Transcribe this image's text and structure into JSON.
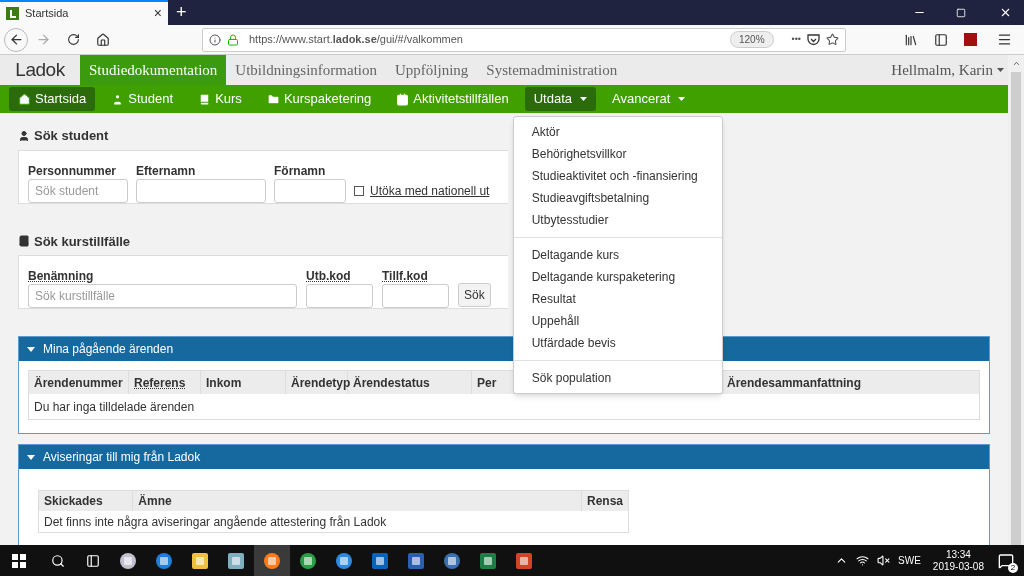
{
  "browser": {
    "tab": {
      "title": "Startsida",
      "close": "×"
    },
    "new_tab": "+",
    "url": "https://www.start.**ladok.se**/gui/#/valkommen",
    "zoom": "120%",
    "more": "•••"
  },
  "top_menu": {
    "logo": "Ladok",
    "items": [
      {
        "label": "Studiedokumentation",
        "selected": true
      },
      {
        "label": "Utbildningsinformation",
        "selected": false
      },
      {
        "label": "Uppföljning",
        "selected": false
      },
      {
        "label": "Systemadministration",
        "selected": false
      }
    ],
    "user": "Hellmalm, Karin"
  },
  "nav": [
    {
      "kind": "link",
      "label": "Startsida",
      "selected": true
    },
    {
      "kind": "link",
      "label": "Student",
      "selected": false
    },
    {
      "kind": "link",
      "label": "Kurs",
      "selected": false
    },
    {
      "kind": "link",
      "label": "Kurspaketering",
      "selected": false
    },
    {
      "kind": "link",
      "label": "Aktivitetstillfällen",
      "selected": false
    },
    {
      "kind": "menu",
      "label": "Utdata",
      "expanded": true,
      "menu_groups": [
        [
          "Aktör",
          "Behörighetsvillkor",
          "Studieaktivitet och -finansiering",
          "Studieavgiftsbetalning",
          "Utbytesstudier"
        ],
        [
          "Deltagande kurs",
          "Deltagande kurspaketering",
          "Resultat",
          "Uppehåll",
          "Utfärdade bevis"
        ],
        [
          "Sök population"
        ]
      ]
    },
    {
      "kind": "menu",
      "label": "Avancerat",
      "expanded": false
    }
  ],
  "search_student": {
    "title": "Sök student",
    "fields": [
      {
        "label": "Personnummer",
        "placeholder": "Sök student"
      },
      {
        "label": "Efternamn"
      },
      {
        "label": "Förnamn"
      }
    ],
    "checkbox": {
      "label": "Utöka med nationell ut",
      "checked": false
    }
  },
  "search_course": {
    "title": "Sök kurstillfälle",
    "fields": [
      {
        "label": "Benämning",
        "placeholder": "Sök kurstillfälle"
      },
      {
        "label": "Utb.kod"
      },
      {
        "label": "Tillf.kod"
      }
    ],
    "button": "Sök"
  },
  "cases_panel": {
    "title": "Mina pågående ärenden",
    "expanded": true,
    "columns": [
      {
        "label": "Ärendenummer",
        "sortable": false
      },
      {
        "label": "Referens",
        "sortable": true
      },
      {
        "label": "Inkom",
        "sortable": false
      },
      {
        "label": "Ärendetyp",
        "sortable": false
      },
      {
        "label": "Ärendestatus",
        "sortable": false
      },
      {
        "label": "Per",
        "sortable": false
      },
      {
        "label": "Ärendesammanfattning",
        "sortable": false
      }
    ],
    "empty": "Du har inga tilldelade ärenden"
  },
  "notices_panel": {
    "title": "Aviseringar till mig från Ladok",
    "expanded": true,
    "columns": [
      "Skickades",
      "Ämne",
      "Rensa"
    ],
    "empty": "Det finns inte några aviseringar angående attestering från Ladok"
  },
  "taskbar": {
    "language": "SWE",
    "time": "13:34",
    "date": "2019-03-08",
    "notifications": "2"
  }
}
